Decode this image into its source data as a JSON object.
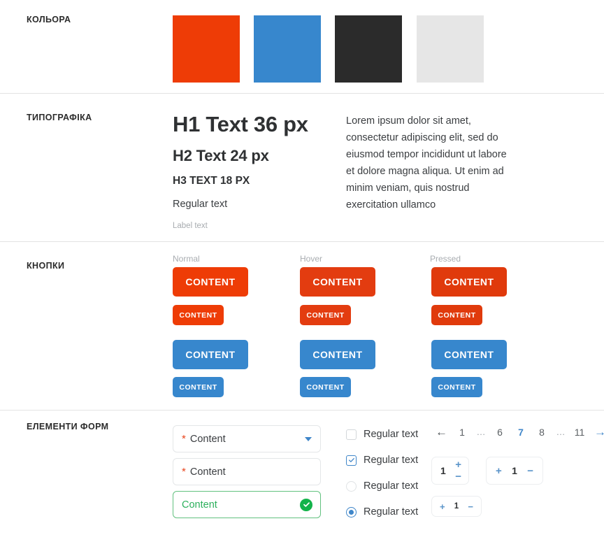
{
  "sections": {
    "colors": {
      "label": "КОЛЬОРА"
    },
    "typography": {
      "label": "ТИПОГРАФІКА"
    },
    "buttons": {
      "label": "КНОПКИ"
    },
    "forms": {
      "label": "ЕЛЕМЕНТИ ФОРМ"
    }
  },
  "palette": [
    {
      "name": "primary-red",
      "hex": "#EE3C06"
    },
    {
      "name": "primary-blue",
      "hex": "#3787CD"
    },
    {
      "name": "dark",
      "hex": "#2B2B2B"
    },
    {
      "name": "light-gray",
      "hex": "#E6E6E6"
    }
  ],
  "typography": {
    "h1": "H1 Text 36 px",
    "h2": "H2 Text 24 px",
    "h3": "H3 TEXT 18 PX",
    "regular": "Regular text",
    "label": "Label text",
    "paragraph": "Lorem ipsum dolor sit amet, consectetur adipiscing elit, sed do eiusmod tempor incididunt ut labore et dolore magna aliqua. Ut enim ad minim veniam, quis nostrud exercitation ullamco"
  },
  "buttons": {
    "states": [
      {
        "label": "Normal",
        "red": "#EE3C06",
        "blue": "#3787CD"
      },
      {
        "label": "Hover",
        "red": "#E33C10",
        "blue": "#3787CD"
      },
      {
        "label": "Pressed",
        "red": "#E03A0C",
        "blue": "#3787CD"
      }
    ],
    "content_label": "CONTENT"
  },
  "forms": {
    "select_field": {
      "required_mark": "*",
      "value": "Content",
      "caret_icon": "chevron-down-icon"
    },
    "text_field": {
      "required_mark": "*",
      "value": "Content"
    },
    "valid_field": {
      "value": "Content",
      "status_icon": "check-circle-icon"
    },
    "choices": [
      {
        "type": "checkbox",
        "checked": false,
        "label": "Regular text"
      },
      {
        "type": "checkbox",
        "checked": true,
        "label": "Regular text"
      },
      {
        "type": "radio",
        "checked": false,
        "label": "Regular text"
      },
      {
        "type": "radio",
        "checked": true,
        "label": "Regular text"
      }
    ],
    "pagination": {
      "prev_icon": "arrow-left-icon",
      "next_icon": "arrow-right-icon",
      "pages": [
        "1",
        "…",
        "6",
        "7",
        "8",
        "…",
        "11"
      ],
      "current": "7"
    },
    "steppers": [
      {
        "name": "stepper-vertical",
        "value": "1",
        "plus": "+",
        "minus": "−"
      },
      {
        "name": "stepper-horizontal",
        "value": "1",
        "plus": "+",
        "minus": "−"
      },
      {
        "name": "stepper-horizontal-small",
        "value": "1",
        "plus": "+",
        "minus": "−"
      }
    ]
  }
}
